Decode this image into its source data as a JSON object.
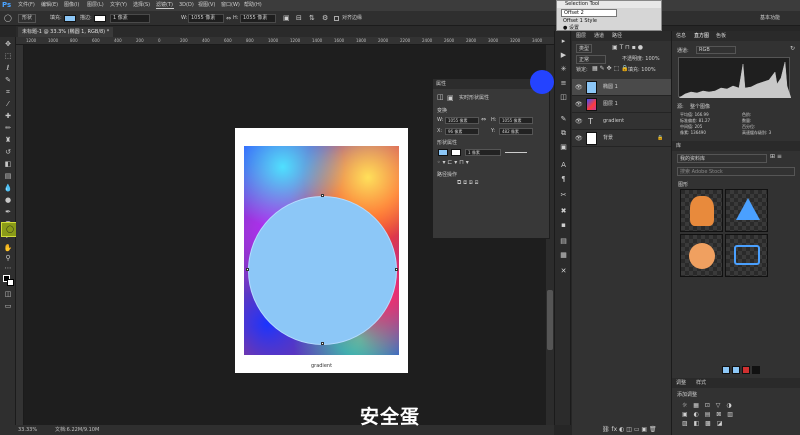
{
  "app": {
    "logo": "Ps"
  },
  "menu": [
    "文件(F)",
    "编辑(E)",
    "图像(I)",
    "图层(L)",
    "文字(Y)",
    "选择(S)",
    "滤镜(T)",
    "3D(D)",
    "视图(V)",
    "窗口(W)",
    "帮助(H)"
  ],
  "options": {
    "tool_mode": "形状",
    "fill_label": "填充:",
    "stroke_label": "描边:",
    "stroke_width": "1 像素",
    "w_label": "W:",
    "w_value": "1055 像素",
    "h_label": "H:",
    "h_value": "1055 像素",
    "align_edges": "对齐边缘",
    "workspace": "基本功能",
    "fill_color": "#8cc7f7"
  },
  "document": {
    "tab_title": "未标题-1 @ 33.3% (椭圆 1, RGB/8) *",
    "zoom": "33.33%",
    "doc_info": "文档:6.22M/9.10M",
    "caption": "gradient"
  },
  "ruler_ticks": [
    "1200",
    "1000",
    "800",
    "600",
    "400",
    "200",
    "0",
    "200",
    "400",
    "600",
    "800",
    "1000",
    "1200",
    "1400",
    "1600",
    "1800",
    "2000",
    "2200",
    "2400",
    "2600",
    "2800",
    "3000",
    "3200",
    "3400"
  ],
  "properties": {
    "title": "属性",
    "section": "实时形状属性",
    "transform": "变换",
    "w": "1055 像素",
    "h": "1055 像素",
    "x": "96 像素",
    "y": "482 像素",
    "shape_props": "形状属性",
    "stroke_size": "1 像素",
    "path_ops": "路径操作",
    "w_label": "W:",
    "h_label": "H:",
    "x_label": "X:",
    "y_label": "Y:"
  },
  "selection_tool": {
    "title": "Selection Tool",
    "row1": "Offset 2",
    "row2": "Offset 1    Style",
    "row3": "● 设置"
  },
  "layers": {
    "tabs": [
      "图层",
      "通道",
      "路径"
    ],
    "kind": "类型",
    "blend": "正常",
    "opacity": "不透明度: 100%",
    "lock": "锁定:",
    "fill": "填充: 100%",
    "items": [
      {
        "name": "椭圆 1",
        "selected": true,
        "thumb_color": "#8cc7f7"
      },
      {
        "name": "图层 1",
        "selected": false,
        "thumb_color": "#c23aa0"
      },
      {
        "name": "gradient",
        "selected": false,
        "thumb_color": ""
      },
      {
        "name": "背景",
        "selected": false,
        "thumb_color": "#ffffff"
      }
    ]
  },
  "right_panel": {
    "tabs_top": [
      "信息",
      "直方图",
      "色板"
    ],
    "channel_label": "通道:",
    "channel_value": "RGB",
    "source_label": "源:",
    "source_value": "整个图像",
    "stats_left": [
      "平均值: 166.99",
      "标准偏差: 81.27",
      "中间值: 205",
      "像素: 136490"
    ],
    "stats_right": [
      "色阶:",
      "数量:",
      "百分位:",
      "高速缓存级别: 3"
    ],
    "library_tab": "库",
    "library_name": "我的资料库",
    "search_placeholder": "搜索 Adobe Stock",
    "graphics_label": "图形",
    "swatches": [
      "#8cc7f7",
      "#8cc7f7",
      "#d03030",
      "#111111"
    ],
    "adjust_tabs": [
      "调整",
      "样式"
    ],
    "adjust_add": "添加调整"
  },
  "subtitle": "安全蛋"
}
